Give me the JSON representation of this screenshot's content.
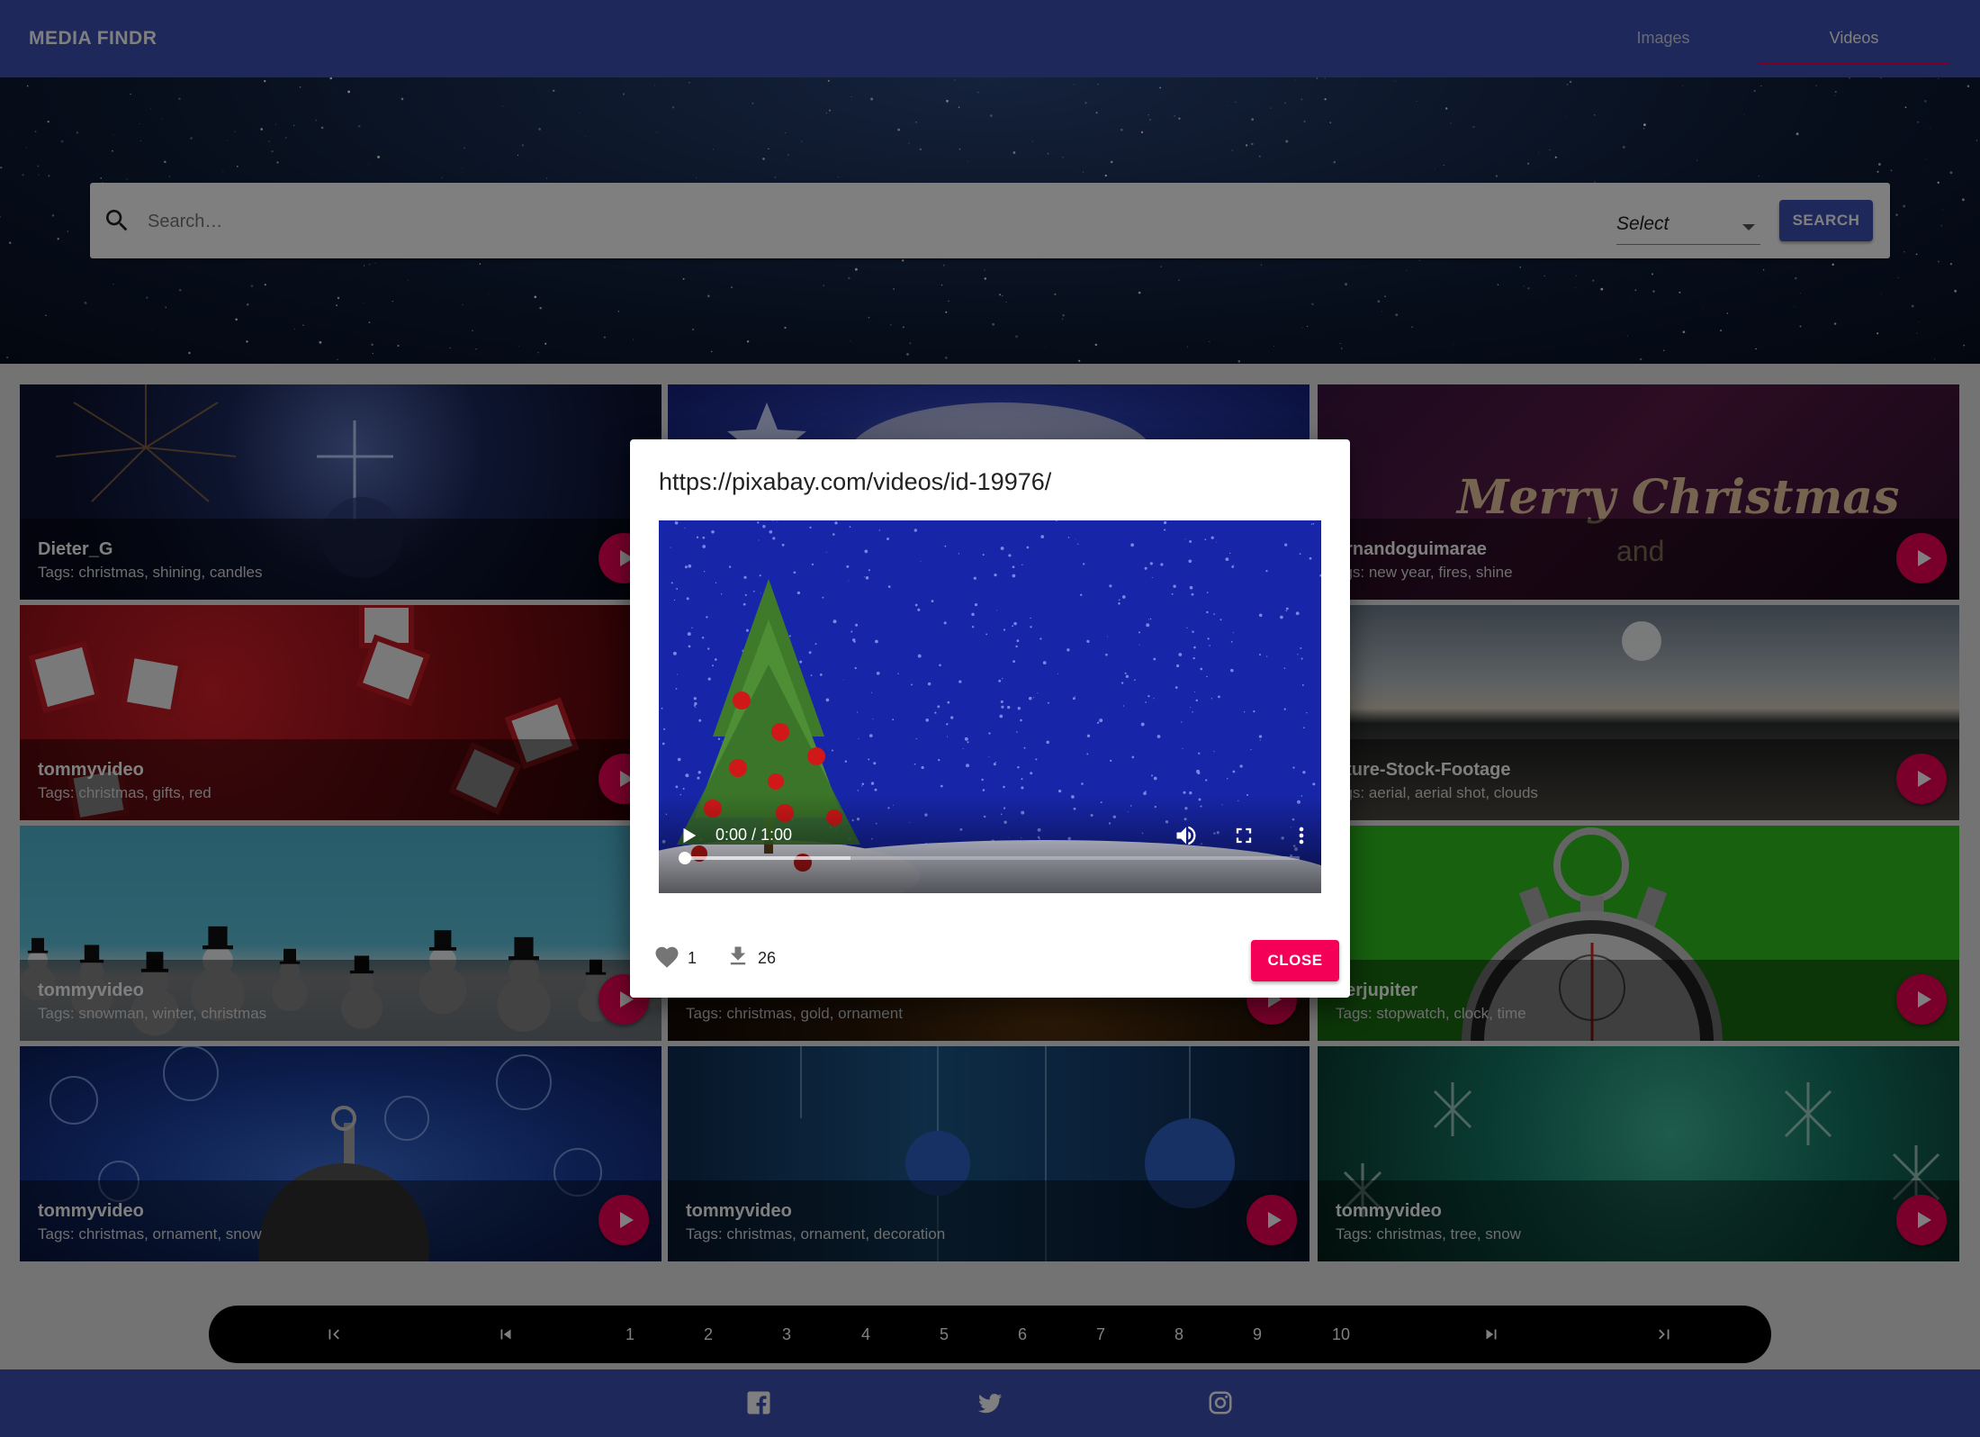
{
  "app": {
    "title": "MEDIA FINDR"
  },
  "nav": {
    "tabs": [
      {
        "label": "Images"
      },
      {
        "label": "Videos"
      }
    ],
    "active_tab": "Videos"
  },
  "search": {
    "placeholder": "Search…",
    "value": "",
    "select_value": "Select",
    "button_label": "SEARCH"
  },
  "cards": [
    {
      "user": "Dieter_G",
      "tags": "Tags: christmas, shining, candles"
    },
    {
      "user": "",
      "tags": ""
    },
    {
      "user": "ernandoguimarae",
      "tags": "ags: new year, fires, shine",
      "overlay_text": "Merry Christmas",
      "overlay_text2": "and"
    },
    {
      "user": "tommyvideo",
      "tags": "Tags: christmas, gifts, red"
    },
    {
      "user": "",
      "tags": ""
    },
    {
      "user": "ature-Stock-Footage",
      "tags": "ags: aerial, aerial shot, clouds"
    },
    {
      "user": "tommyvideo",
      "tags": "Tags: snowman, winter, christmas"
    },
    {
      "user": "",
      "tags": "Tags: christmas, gold, ornament"
    },
    {
      "user": "verjupiter",
      "tags": "Tags: stopwatch, clock, time"
    },
    {
      "user": "tommyvideo",
      "tags": "Tags: christmas, ornament, snow"
    },
    {
      "user": "tommyvideo",
      "tags": "Tags: christmas, ornament, decoration"
    },
    {
      "user": "tommyvideo",
      "tags": "Tags: christmas, tree, snow"
    }
  ],
  "pagination": {
    "pages": [
      "1",
      "2",
      "3",
      "4",
      "5",
      "6",
      "7",
      "8",
      "9",
      "10"
    ]
  },
  "modal": {
    "title": "https://pixabay.com/videos/id-19976/",
    "video_time": "0:00 / 1:00",
    "progress_fraction": 0.27,
    "likes": "1",
    "downloads": "26",
    "close_label": "CLOSE"
  },
  "colors": {
    "primary": "#3f51b5",
    "accent": "#f50057"
  },
  "icons": [
    "search-icon",
    "play-icon",
    "heart-icon",
    "download-icon",
    "facebook-icon",
    "twitter-icon",
    "instagram-icon",
    "volume-icon",
    "fullscreen-icon",
    "more-vert-icon"
  ]
}
